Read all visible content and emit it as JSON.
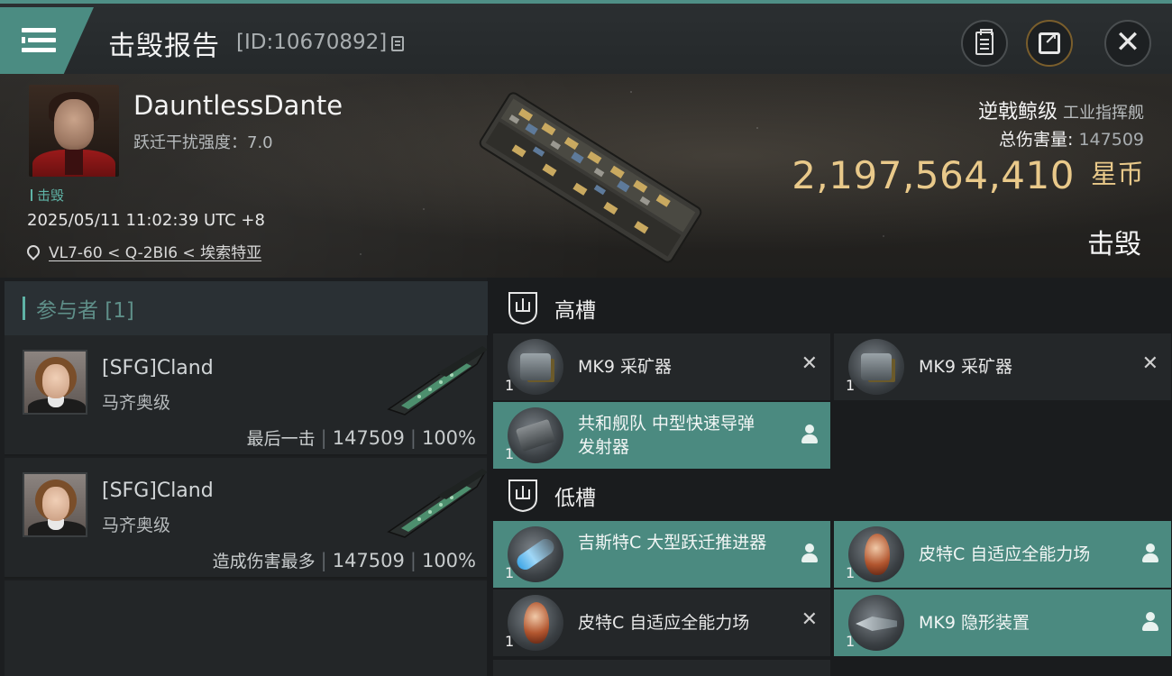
{
  "header": {
    "title": "击毁报告",
    "report_id": "[ID:10670892]"
  },
  "victim": {
    "name": "DauntlessDante",
    "warp_disruption": "跃迁干扰强度：7.0",
    "kill_tag": "击毁",
    "time": "2025/05/11 11:02:39 UTC +8",
    "location": "VL7-60 < Q-2BI6 < 埃索特亚",
    "ship_class": "逆戟鲸级",
    "ship_type": "工业指挥舰",
    "total_damage_label": "总伤害量:",
    "total_damage_value": "147509",
    "isk_value": "2,197,564,410",
    "isk_unit": "星币",
    "status": "击毁"
  },
  "participants": {
    "header": "参与者 [1]",
    "rows": [
      {
        "name": "[SFG]Cland",
        "ship": "马齐奥级",
        "label": "最后一击",
        "damage": "147509",
        "percent": "100%"
      },
      {
        "name": "[SFG]Cland",
        "ship": "马齐奥级",
        "label": "造成伤害最多",
        "damage": "147509",
        "percent": "100%"
      }
    ]
  },
  "fitting": {
    "high_slots": {
      "title": "高槽",
      "items": [
        {
          "name": "MK9 采矿器",
          "qty": "1",
          "state": "destroyed",
          "icon": "mining-laser-icon"
        },
        {
          "name": "MK9 采矿器",
          "qty": "1",
          "state": "destroyed",
          "icon": "mining-laser-icon"
        },
        {
          "name": "共和舰队 中型快速导弹发射器",
          "qty": "1",
          "state": "dropped",
          "icon": "missile-launcher-icon"
        }
      ]
    },
    "low_slots": {
      "title": "低槽",
      "items": [
        {
          "name": "吉斯特C 大型跃迁推进器",
          "qty": "1",
          "state": "dropped",
          "icon": "microwarpdrive-icon"
        },
        {
          "name": "皮特C 自适应全能力场",
          "qty": "1",
          "state": "dropped",
          "icon": "shield-hardener-icon"
        },
        {
          "name": "皮特C 自适应全能力场",
          "qty": "1",
          "state": "destroyed",
          "icon": "shield-hardener-icon"
        },
        {
          "name": "MK9 隐形装置",
          "qty": "1",
          "state": "dropped",
          "icon": "cloaking-device-icon"
        }
      ]
    }
  },
  "colors": {
    "accent": "#4b8a80",
    "isk_gold": "#e9c98a",
    "panel": "#242729"
  }
}
